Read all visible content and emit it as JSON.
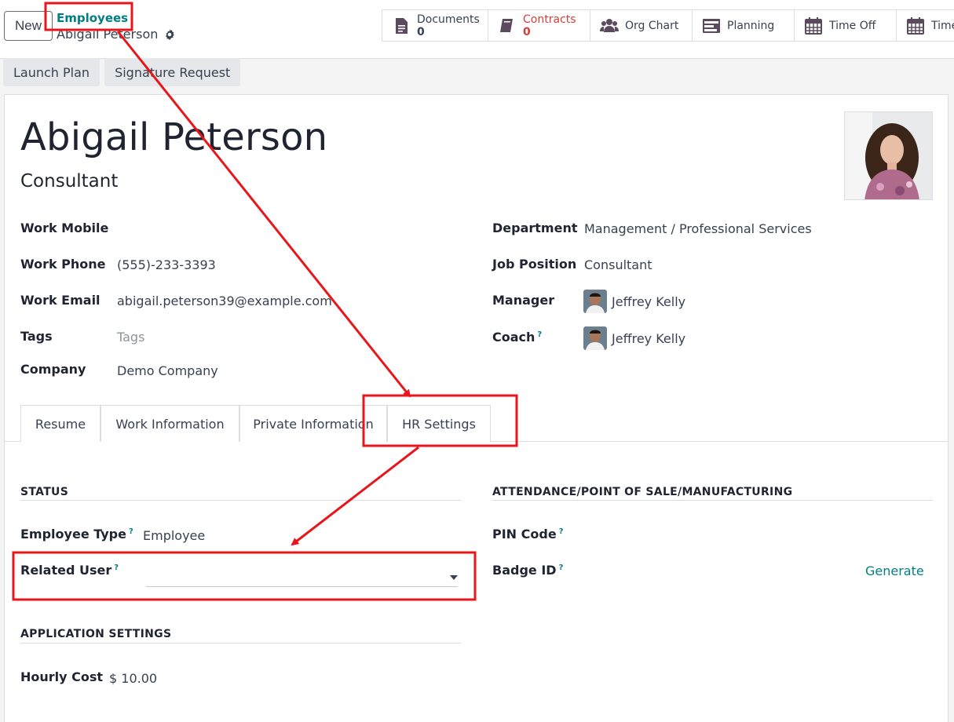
{
  "header": {
    "new_label": "New",
    "breadcrumb_parent": "Employees",
    "breadcrumb_current": "Abigail Peterson",
    "smart_buttons": [
      {
        "label": "Documents",
        "count": "0",
        "icon": "document-icon"
      },
      {
        "label": "Contracts",
        "count": "0",
        "icon": "book-icon"
      },
      {
        "label": "Org Chart",
        "icon": "users-icon"
      },
      {
        "label": "Planning",
        "icon": "planning-icon"
      },
      {
        "label": "Time Off",
        "icon": "calendar-icon"
      },
      {
        "label": "Time",
        "icon": "calendar-icon"
      }
    ]
  },
  "actions": {
    "launch_plan": "Launch Plan",
    "signature_request": "Signature Request"
  },
  "employee": {
    "name": "Abigail Peterson",
    "job_title": "Consultant"
  },
  "fields_left": {
    "work_mobile_label": "Work Mobile",
    "work_phone_label": "Work Phone",
    "work_phone_value": "(555)-233-3393",
    "work_email_label": "Work Email",
    "work_email_value": "abigail.peterson39@example.com",
    "tags_label": "Tags",
    "tags_placeholder": "Tags",
    "company_label": "Company",
    "company_value": "Demo Company"
  },
  "fields_right": {
    "department_label": "Department",
    "department_value": "Management / Professional Services",
    "job_position_label": "Job Position",
    "job_position_value": "Consultant",
    "manager_label": "Manager",
    "manager_value": "Jeffrey Kelly",
    "coach_label": "Coach",
    "coach_value": "Jeffrey Kelly",
    "help_mark": "?"
  },
  "tabs": [
    "Resume",
    "Work Information",
    "Private Information",
    "HR Settings"
  ],
  "hr_settings": {
    "status_title": "STATUS",
    "employee_type_label": "Employee Type",
    "employee_type_value": "Employee",
    "related_user_label": "Related User",
    "application_title": "APPLICATION SETTINGS",
    "hourly_cost_label": "Hourly Cost",
    "hourly_cost_value": "$ 10.00",
    "attendance_title": "ATTENDANCE/POINT OF SALE/MANUFACTURING",
    "pin_code_label": "PIN Code",
    "badge_id_label": "Badge ID",
    "generate_label": "Generate"
  },
  "colors": {
    "accent": "#017e84",
    "alert": "#d23f3a",
    "annotation": "#e8151b"
  }
}
